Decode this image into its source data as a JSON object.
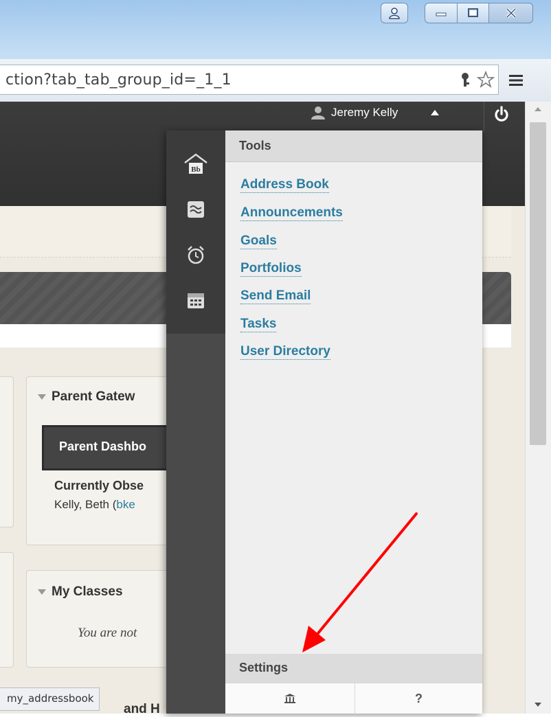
{
  "browser": {
    "url_text": "ction?tab_tab_group_id=_1_1",
    "status_tooltip": "my_addressbook"
  },
  "topnav": {
    "user_name": "Jeremy Kelly"
  },
  "cards": {
    "parent_gateway": {
      "title": "Parent Gatew",
      "dashboard_button": "Parent Dashbo",
      "observing_heading": "Currently Obse",
      "observing_name": "Kelly, Beth (",
      "observing_link": "bke"
    },
    "my_classes": {
      "title": "My Classes",
      "empty_text": "You are not"
    },
    "partial_card_title": "and H"
  },
  "flyout": {
    "tools_heading": "Tools",
    "tools": [
      {
        "label": "Address Book"
      },
      {
        "label": "Announcements"
      },
      {
        "label": "Goals"
      },
      {
        "label": "Portfolios"
      },
      {
        "label": "Send Email"
      },
      {
        "label": "Tasks"
      },
      {
        "label": "User Directory"
      }
    ],
    "settings_heading": "Settings",
    "help_label": "?",
    "rail_icons": [
      "bb-home-icon",
      "activity-stream-icon",
      "alarm-clock-icon",
      "calendar-icon"
    ]
  },
  "colors": {
    "link": "#2b7da0",
    "annotation_arrow": "#ff0000",
    "topnav": "#3a3a3a"
  }
}
